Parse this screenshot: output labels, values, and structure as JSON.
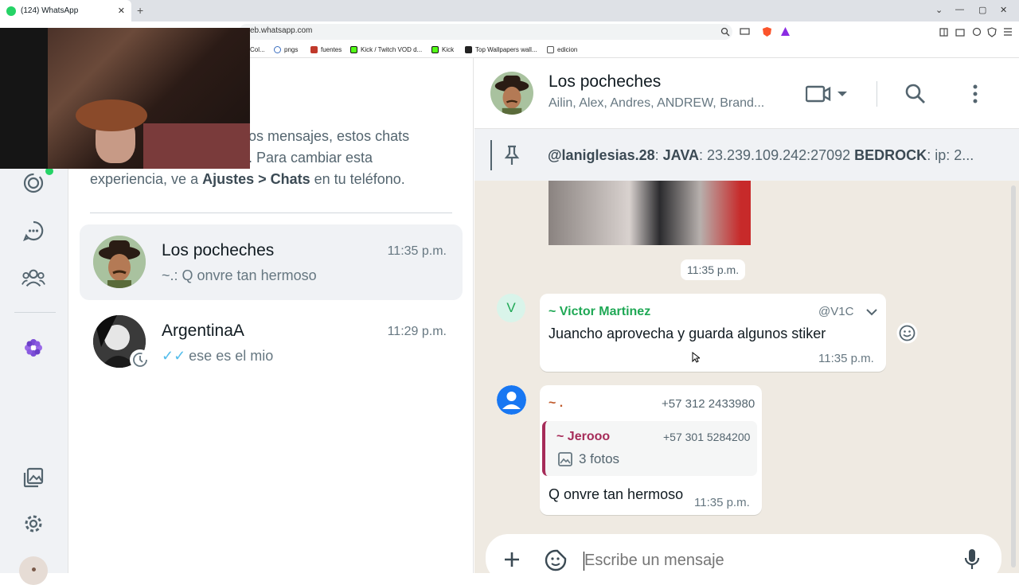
{
  "browser": {
    "tab_title": "(124) WhatsApp",
    "tab_close": "✕",
    "new_tab": "+",
    "url": "eb.whatsapp.com",
    "window_controls": [
      "⌄",
      "—",
      "▢",
      "✕"
    ],
    "bookmarks": [
      {
        "label": "Col...",
        "icon": "bookmark-icon"
      },
      {
        "label": "pngs",
        "icon": "pin-icon"
      },
      {
        "label": "fuentes",
        "icon": "fuentes-icon"
      },
      {
        "label": "Kick / Twitch VOD d...",
        "icon": "kick-icon"
      },
      {
        "label": "Kick",
        "icon": "kick-icon"
      },
      {
        "label": "Top Wallpapers wall...",
        "icon": "wallpaper-icon"
      },
      {
        "label": "edicion",
        "icon": "folder-icon"
      }
    ]
  },
  "sidebar": {
    "info_pre": "os mensajes, estos chats",
    "info_mid": ". Para cambiar esta",
    "info_exp": "experiencia, ve a ",
    "info_bold": "Ajustes > Chats",
    "info_post": " en tu teléfono."
  },
  "chats": [
    {
      "name": "Los pocheches",
      "time": "11:35 p.m.",
      "last": "~.: Q onvre tan hermoso",
      "active": true
    },
    {
      "name": "ArgentinaA",
      "time": "11:29 p.m.",
      "last": "ese es el mio",
      "read_ticks": "✓✓"
    }
  ],
  "conversation": {
    "title": "Los pocheches",
    "subtitle": "Ailin, Alex, Andres, ANDREW, Brand...",
    "pinned_user": "@laniglesias.28",
    "pinned_java_label": "JAVA",
    "pinned_java_value": ": 23.239.109.242:27092 ",
    "pinned_bedrock_label": "BEDROCK",
    "pinned_tail": ":  ip: 2...",
    "time_chip": "11:35 p.m.",
    "messages": [
      {
        "avatar_letter": "V",
        "sender": "~ Victor Martinez",
        "handle": "@V1C",
        "text": "Juancho aprovecha y guarda algunos stiker",
        "time": "11:35 p.m."
      },
      {
        "sender": "~ .",
        "phone": "+57 312 2433980",
        "quote_sender": "~ Jerooo",
        "quote_phone": "+57 301 5284200",
        "quote_text": "3 fotos",
        "text": "Q onvre tan hermoso",
        "time": "11:35 p.m."
      }
    ],
    "composer_placeholder": "Escribe un mensaje"
  },
  "colors": {
    "green": "#25d366",
    "sender_victor": "#1fa855",
    "sender_jerooo": "#a62c59",
    "sender_dot": "#c0592a",
    "chat_bg": "#efeae2"
  }
}
